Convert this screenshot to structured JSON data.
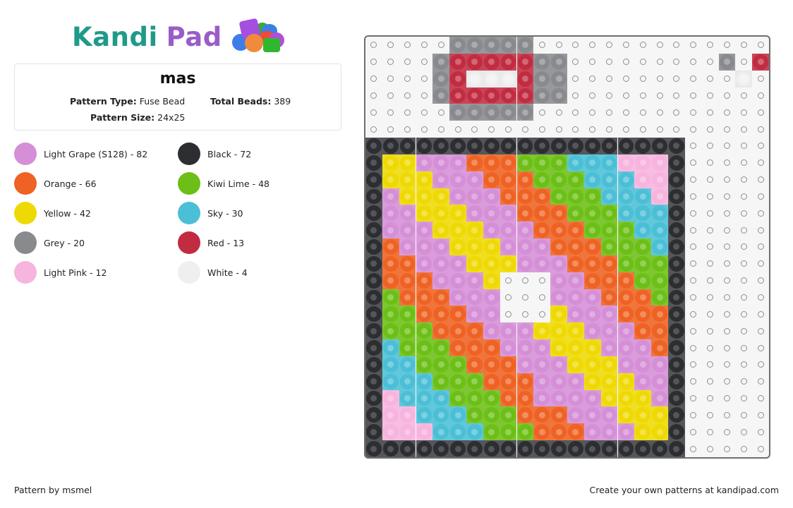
{
  "logo": {
    "word1": "Kandi",
    "word2": "Pad",
    "colors": {
      "kandi": "#1f9a8a",
      "pad": "#9a5cc8"
    }
  },
  "pattern": {
    "title": "mas",
    "type_label": "Pattern Type:",
    "type_value": "Fuse Bead",
    "total_label": "Total Beads:",
    "total_value": "389",
    "size_label": "Pattern Size:",
    "size_value": "24x25"
  },
  "legend": [
    {
      "key": "G",
      "label": "Light Grape (S128) - 82",
      "name": "Light Grape (S128)",
      "count": 82,
      "color": "#d58fd6"
    },
    {
      "key": "B",
      "label": "Black - 72",
      "name": "Black",
      "count": 72,
      "color": "#2d2e32"
    },
    {
      "key": "O",
      "label": "Orange - 66",
      "name": "Orange",
      "count": 66,
      "color": "#ee6223"
    },
    {
      "key": "L",
      "label": "Kiwi Lime - 48",
      "name": "Kiwi Lime",
      "count": 48,
      "color": "#6cbf16"
    },
    {
      "key": "Y",
      "label": "Yellow - 42",
      "name": "Yellow",
      "count": 42,
      "color": "#eed904"
    },
    {
      "key": "S",
      "label": "Sky - 30",
      "name": "Sky",
      "count": 30,
      "color": "#4bbfd6"
    },
    {
      "key": "R",
      "label": "Grey - 20",
      "name": "Grey",
      "count": 20,
      "color": "#898a8e"
    },
    {
      "key": "D",
      "label": "Red - 13",
      "name": "Red",
      "count": 13,
      "color": "#c12c41"
    },
    {
      "key": "P",
      "label": "Light Pink - 12",
      "name": "Light Pink",
      "count": 12,
      "color": "#f6b4de"
    },
    {
      "key": "W",
      "label": "White - 4",
      "name": "White",
      "count": 4,
      "color": "#efefef"
    }
  ],
  "grid": {
    "cols": 24,
    "rows": 25,
    "legend_keys": "Each character is one peg; '.' = empty peg; letters map to legend[].key",
    "cells": [
      ".....RRRRR..............",
      "....RDDDDDRR.........R.D",
      "....RDWWWDRR..........W.",
      "....RDDDDDRR............",
      ".....RRRRR..............",
      "........................",
      "BBBBBBBBBBBBBBBBBBB.....",
      "BYYGGGOOOLLLSSSPPPB.....",
      "BYYYGGGOOOLLLSSSPPB.....",
      "BGYYYGGGOOOLLLSSSPB.....",
      "BGGYYYGGGOOOLLLSSSB.....",
      "BGGGYYYGGGOOOLLLSSB.....",
      "BOGGGYYYGGGOOOLLLSB.....",
      "BOOGGGYYYGGGOOOLLLB.....",
      "BOOOGGGY...GGOOOLLB.....",
      "BLOOOGGG...GGGOOOLB.....",
      "BLLOOOGG...YGGGOOOB.....",
      "BLLLOOOGGGYYYGGGOOB.....",
      "BSLLLOOOGGGYYYGGGOB.....",
      "BSSLLLOOOGGGYYYGGGB.....",
      "BSSSLLLOOOGGGYYYGGB.....",
      "BPSSSLLLOOGGGGYYYGB.....",
      "BPPSSSLLLOOOGGGYYYB.....",
      "BPPPSSSLLLOOOGGGYYB.....",
      "BBBBBBBBBBBBBBBBBBB....."
    ]
  },
  "footer": {
    "credit": "Pattern by msmel",
    "promo": "Create your own patterns at kandipad.com"
  }
}
